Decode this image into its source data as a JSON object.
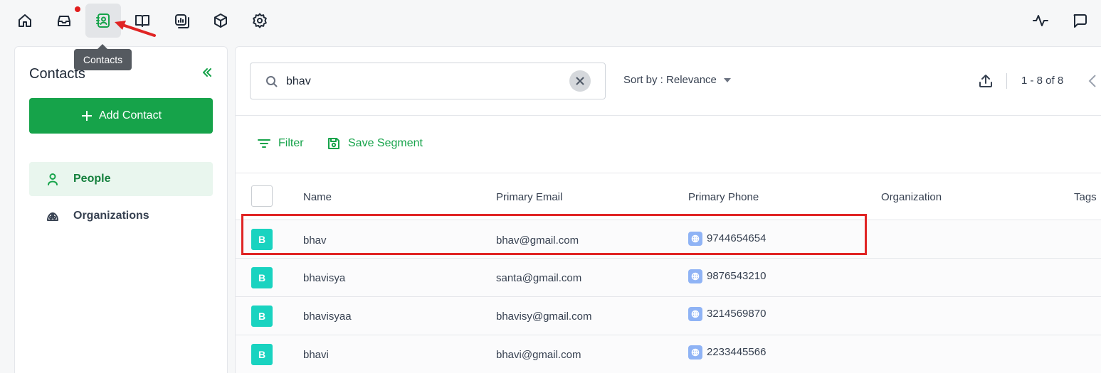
{
  "nav": {
    "items": [
      "home-icon",
      "inbox-icon",
      "contacts-icon",
      "book-icon",
      "reports-icon",
      "box-icon",
      "gear-icon"
    ],
    "right_items": [
      "activity-icon",
      "chat-icon"
    ]
  },
  "tooltip": "Contacts",
  "sidebar": {
    "title": "Contacts",
    "add_button": "Add Contact",
    "items": [
      {
        "label": "People"
      },
      {
        "label": "Organizations"
      }
    ]
  },
  "search": {
    "value": "bhav",
    "placeholder": ""
  },
  "sort_label": "Sort by : Relevance",
  "pagination": "1 - 8 of 8",
  "toolbar": {
    "filter": "Filter",
    "save_segment": "Save Segment"
  },
  "table": {
    "columns": [
      "Name",
      "Primary Email",
      "Primary Phone",
      "Organization",
      "Tags"
    ],
    "rows": [
      {
        "initial": "B",
        "name": "bhav",
        "email": "bhav@gmail.com",
        "phone": "9744654654"
      },
      {
        "initial": "B",
        "name": "bhavisya",
        "email": "santa@gmail.com",
        "phone": "9876543210"
      },
      {
        "initial": "B",
        "name": "bhavisyaa",
        "email": "bhavisy@gmail.com",
        "phone": "3214569870"
      },
      {
        "initial": "B",
        "name": "bhavi",
        "email": "bhavi@gmail.com",
        "phone": "2233445566"
      }
    ]
  },
  "colors": {
    "accent": "#16a34a",
    "avatar": "#19d3c0",
    "annotation": "#e02424"
  }
}
